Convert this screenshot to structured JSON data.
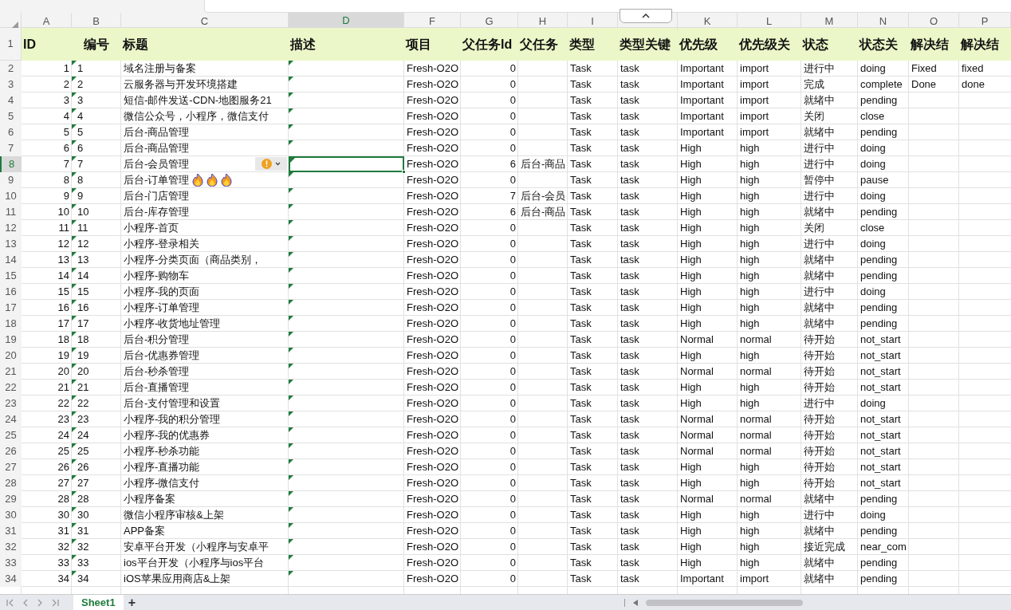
{
  "columns": [
    {
      "letter": "A",
      "selected": false
    },
    {
      "letter": "B",
      "selected": false
    },
    {
      "letter": "C",
      "selected": false
    },
    {
      "letter": "D",
      "selected": true
    },
    {
      "letter": "F",
      "selected": false
    },
    {
      "letter": "G",
      "selected": false
    },
    {
      "letter": "H",
      "selected": false
    },
    {
      "letter": "I",
      "selected": false
    },
    {
      "kind": "collapse-tab"
    },
    {
      "letter": "K",
      "selected": false
    },
    {
      "letter": "L",
      "selected": false
    },
    {
      "letter": "M",
      "selected": false
    },
    {
      "letter": "N",
      "selected": false
    },
    {
      "letter": "O",
      "selected": false
    },
    {
      "letter": "P",
      "selected": false
    }
  ],
  "header_row": {
    "label": "1",
    "cells": [
      "ID",
      "编号",
      "标题",
      "描述",
      "项目",
      "父任务Id",
      "父任务",
      "类型",
      "类型关键",
      "优先级",
      "优先级关",
      "状态",
      "状态关",
      "解决结",
      "解决结"
    ]
  },
  "rows": [
    {
      "label": "2",
      "selected": false,
      "cells": [
        "1",
        "1",
        "域名注册与备案",
        "",
        "Fresh-O2O",
        "0",
        "",
        "Task",
        "task",
        "Important",
        "import",
        "进行中",
        "doing",
        "Fixed",
        "fixed"
      ]
    },
    {
      "label": "3",
      "selected": false,
      "cells": [
        "2",
        "2",
        "云服务器与开发环境搭建",
        "",
        "Fresh-O2O",
        "0",
        "",
        "Task",
        "task",
        "Important",
        "import",
        "完成",
        "complete",
        "Done",
        "done"
      ]
    },
    {
      "label": "4",
      "selected": false,
      "cells": [
        "3",
        "3",
        "短信-邮件发送-CDN-地图服务21",
        "",
        "Fresh-O2O",
        "0",
        "",
        "Task",
        "task",
        "Important",
        "import",
        "就绪中",
        "pending",
        "",
        ""
      ]
    },
    {
      "label": "5",
      "selected": false,
      "cells": [
        "4",
        "4",
        "微信公众号，小程序，微信支付",
        "",
        "Fresh-O2O",
        "0",
        "",
        "Task",
        "task",
        "Important",
        "import",
        "关闭",
        "close",
        "",
        ""
      ]
    },
    {
      "label": "6",
      "selected": false,
      "cells": [
        "5",
        "5",
        "后台-商品管理",
        "",
        "Fresh-O2O",
        "0",
        "",
        "Task",
        "task",
        "Important",
        "import",
        "就绪中",
        "pending",
        "",
        ""
      ]
    },
    {
      "label": "7",
      "selected": false,
      "cells": [
        "6",
        "6",
        "后台-商品管理",
        "",
        "Fresh-O2O",
        "0",
        "",
        "Task",
        "task",
        "High",
        "high",
        "进行中",
        "doing",
        "",
        ""
      ]
    },
    {
      "label": "8",
      "selected": true,
      "error_tag": true,
      "cells": [
        "7",
        "7",
        "后台-会员管理",
        "",
        "Fresh-O2O",
        "6",
        "后台-商品",
        "Task",
        "task",
        "High",
        "high",
        "进行中",
        "doing",
        "",
        ""
      ]
    },
    {
      "label": "9",
      "selected": false,
      "title_icons": [
        {
          "kind": "flame"
        },
        {
          "kind": "flame"
        },
        {
          "kind": "flame"
        }
      ],
      "cells": [
        "8",
        "8",
        "后台-订单管理",
        "",
        "Fresh-O2O",
        "0",
        "",
        "Task",
        "task",
        "High",
        "high",
        "暂停中",
        "pause",
        "",
        ""
      ]
    },
    {
      "label": "10",
      "selected": false,
      "cells": [
        "9",
        "9",
        "后台-门店管理",
        "",
        "Fresh-O2O",
        "7",
        "后台-会员",
        "Task",
        "task",
        "High",
        "high",
        "进行中",
        "doing",
        "",
        ""
      ]
    },
    {
      "label": "11",
      "selected": false,
      "cells": [
        "10",
        "10",
        "后台-库存管理",
        "",
        "Fresh-O2O",
        "6",
        "后台-商品",
        "Task",
        "task",
        "High",
        "high",
        "就绪中",
        "pending",
        "",
        ""
      ]
    },
    {
      "label": "12",
      "selected": false,
      "cells": [
        "11",
        "11",
        "小程序-首页",
        "",
        "Fresh-O2O",
        "0",
        "",
        "Task",
        "task",
        "High",
        "high",
        "关闭",
        "close",
        "",
        ""
      ]
    },
    {
      "label": "13",
      "selected": false,
      "cells": [
        "12",
        "12",
        "小程序-登录相关",
        "",
        "Fresh-O2O",
        "0",
        "",
        "Task",
        "task",
        "High",
        "high",
        "进行中",
        "doing",
        "",
        ""
      ]
    },
    {
      "label": "14",
      "selected": false,
      "cells": [
        "13",
        "13",
        "小程序-分类页面（商品类别，",
        "",
        "Fresh-O2O",
        "0",
        "",
        "Task",
        "task",
        "High",
        "high",
        "就绪中",
        "pending",
        "",
        ""
      ]
    },
    {
      "label": "15",
      "selected": false,
      "cells": [
        "14",
        "14",
        "小程序-购物车",
        "",
        "Fresh-O2O",
        "0",
        "",
        "Task",
        "task",
        "High",
        "high",
        "就绪中",
        "pending",
        "",
        ""
      ]
    },
    {
      "label": "16",
      "selected": false,
      "cells": [
        "15",
        "15",
        "小程序-我的页面",
        "",
        "Fresh-O2O",
        "0",
        "",
        "Task",
        "task",
        "High",
        "high",
        "进行中",
        "doing",
        "",
        ""
      ]
    },
    {
      "label": "17",
      "selected": false,
      "cells": [
        "16",
        "16",
        "小程序-订单管理",
        "",
        "Fresh-O2O",
        "0",
        "",
        "Task",
        "task",
        "High",
        "high",
        "就绪中",
        "pending",
        "",
        ""
      ]
    },
    {
      "label": "18",
      "selected": false,
      "cells": [
        "17",
        "17",
        "小程序-收货地址管理",
        "",
        "Fresh-O2O",
        "0",
        "",
        "Task",
        "task",
        "High",
        "high",
        "就绪中",
        "pending",
        "",
        ""
      ]
    },
    {
      "label": "19",
      "selected": false,
      "cells": [
        "18",
        "18",
        "后台-积分管理",
        "",
        "Fresh-O2O",
        "0",
        "",
        "Task",
        "task",
        "Normal",
        "normal",
        "待开始",
        "not_start",
        "",
        ""
      ]
    },
    {
      "label": "20",
      "selected": false,
      "cells": [
        "19",
        "19",
        "后台-优惠券管理",
        "",
        "Fresh-O2O",
        "0",
        "",
        "Task",
        "task",
        "High",
        "high",
        "待开始",
        "not_start",
        "",
        ""
      ]
    },
    {
      "label": "21",
      "selected": false,
      "cells": [
        "20",
        "20",
        "后台-秒杀管理",
        "",
        "Fresh-O2O",
        "0",
        "",
        "Task",
        "task",
        "Normal",
        "normal",
        "待开始",
        "not_start",
        "",
        ""
      ]
    },
    {
      "label": "22",
      "selected": false,
      "cells": [
        "21",
        "21",
        "后台-直播管理",
        "",
        "Fresh-O2O",
        "0",
        "",
        "Task",
        "task",
        "High",
        "high",
        "待开始",
        "not_start",
        "",
        ""
      ]
    },
    {
      "label": "23",
      "selected": false,
      "cells": [
        "22",
        "22",
        "后台-支付管理和设置",
        "",
        "Fresh-O2O",
        "0",
        "",
        "Task",
        "task",
        "High",
        "high",
        "进行中",
        "doing",
        "",
        ""
      ]
    },
    {
      "label": "24",
      "selected": false,
      "cells": [
        "23",
        "23",
        "小程序-我的积分管理",
        "",
        "Fresh-O2O",
        "0",
        "",
        "Task",
        "task",
        "Normal",
        "normal",
        "待开始",
        "not_start",
        "",
        ""
      ]
    },
    {
      "label": "25",
      "selected": false,
      "cells": [
        "24",
        "24",
        "小程序-我的优惠券",
        "",
        "Fresh-O2O",
        "0",
        "",
        "Task",
        "task",
        "Normal",
        "normal",
        "待开始",
        "not_start",
        "",
        ""
      ]
    },
    {
      "label": "26",
      "selected": false,
      "cells": [
        "25",
        "25",
        "小程序-秒杀功能",
        "",
        "Fresh-O2O",
        "0",
        "",
        "Task",
        "task",
        "Normal",
        "normal",
        "待开始",
        "not_start",
        "",
        ""
      ]
    },
    {
      "label": "27",
      "selected": false,
      "cells": [
        "26",
        "26",
        "小程序-直播功能",
        "",
        "Fresh-O2O",
        "0",
        "",
        "Task",
        "task",
        "High",
        "high",
        "待开始",
        "not_start",
        "",
        ""
      ]
    },
    {
      "label": "28",
      "selected": false,
      "cells": [
        "27",
        "27",
        "小程序-微信支付",
        "",
        "Fresh-O2O",
        "0",
        "",
        "Task",
        "task",
        "High",
        "high",
        "待开始",
        "not_start",
        "",
        ""
      ]
    },
    {
      "label": "29",
      "selected": false,
      "cells": [
        "28",
        "28",
        "小程序备案",
        "",
        "Fresh-O2O",
        "0",
        "",
        "Task",
        "task",
        "Normal",
        "normal",
        "就绪中",
        "pending",
        "",
        ""
      ]
    },
    {
      "label": "30",
      "selected": false,
      "cells": [
        "30",
        "30",
        "微信小程序审核&上架",
        "",
        "Fresh-O2O",
        "0",
        "",
        "Task",
        "task",
        "High",
        "high",
        "进行中",
        "doing",
        "",
        ""
      ]
    },
    {
      "label": "31",
      "selected": false,
      "cells": [
        "31",
        "31",
        "APP备案",
        "",
        "Fresh-O2O",
        "0",
        "",
        "Task",
        "task",
        "High",
        "high",
        "就绪中",
        "pending",
        "",
        ""
      ]
    },
    {
      "label": "32",
      "selected": false,
      "cells": [
        "32",
        "32",
        "安卓平台开发（小程序与安卓平",
        "",
        "Fresh-O2O",
        "0",
        "",
        "Task",
        "task",
        "High",
        "high",
        "接近完成",
        "near_com",
        "",
        ""
      ]
    },
    {
      "label": "33",
      "selected": false,
      "cells": [
        "33",
        "33",
        "ios平台开发（小程序与ios平台",
        "",
        "Fresh-O2O",
        "0",
        "",
        "Task",
        "task",
        "High",
        "high",
        "就绪中",
        "pending",
        "",
        ""
      ]
    },
    {
      "label": "34",
      "selected": false,
      "cells": [
        "34",
        "34",
        "iOS苹果应用商店&上架",
        "",
        "Fresh-O2O",
        "0",
        "",
        "Task",
        "task",
        "Important",
        "import",
        "就绪中",
        "pending",
        "",
        ""
      ]
    }
  ],
  "sheet_tabs": [
    {
      "label": "Sheet1",
      "selected": true
    }
  ],
  "add_sheet": "+"
}
